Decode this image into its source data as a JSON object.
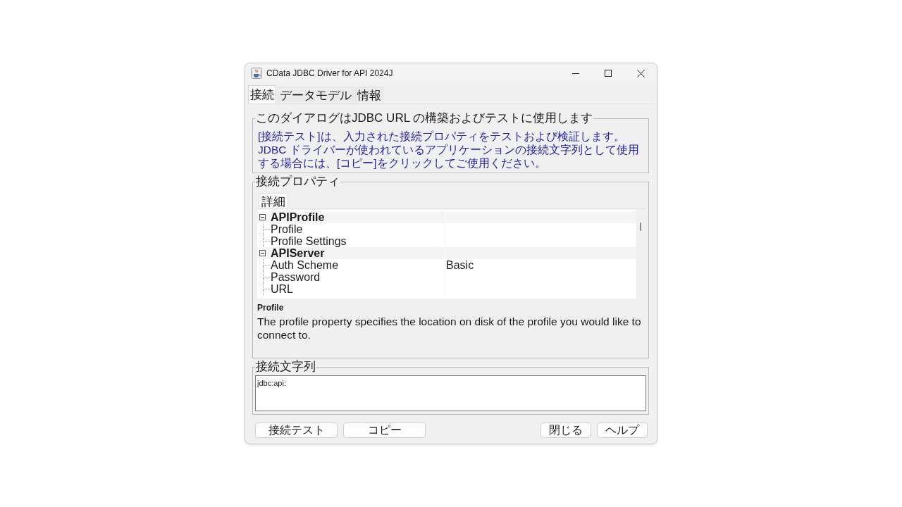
{
  "window": {
    "title": "CData JDBC Driver for API 2024J"
  },
  "tabs": [
    {
      "label": "接続",
      "selected": true
    },
    {
      "label": "データモデル",
      "selected": false
    },
    {
      "label": "情報",
      "selected": false
    }
  ],
  "intro": {
    "legend": "このダイアログはJDBC URL の構築およびテストに使用します",
    "lines": [
      "[接続テスト]は、入力された接続プロパティをテストおよび検証します。",
      "JDBC ドライバーが使われているアプリケーションの接続文字列として使用する場合には、[コピー]をクリックしてご使用ください。"
    ]
  },
  "properties": {
    "legend": "接続プロパティ",
    "subtabs": [
      {
        "label": "詳細",
        "selected": true
      }
    ],
    "groups": [
      {
        "name": "APIProfile",
        "expanded": true,
        "children": [
          {
            "name": "Profile"
          },
          {
            "name": "Profile Settings"
          }
        ]
      },
      {
        "name": "APIServer",
        "expanded": true,
        "children": [
          {
            "name": "Auth Scheme",
            "value": "Basic"
          },
          {
            "name": "Password"
          },
          {
            "name": "URL"
          }
        ]
      }
    ],
    "description": {
      "title": "Profile",
      "text": "The profile property specifies the location on disk of the profile you would like to connect to."
    }
  },
  "connection_string": {
    "legend": "接続文字列",
    "value": "jdbc:api:"
  },
  "actions": {
    "left": [
      {
        "label": "接続テスト"
      },
      {
        "label": "コピー"
      }
    ],
    "right": [
      {
        "label": "閉じる"
      },
      {
        "label": "ヘルプ"
      }
    ]
  }
}
